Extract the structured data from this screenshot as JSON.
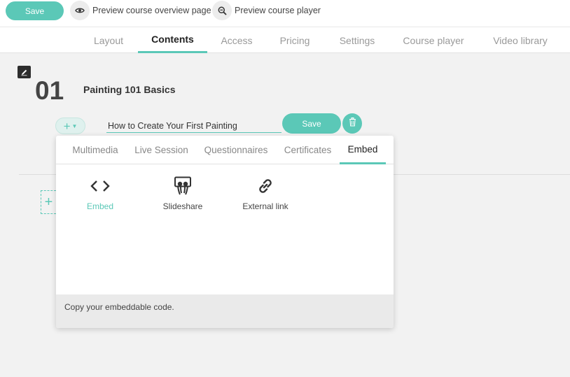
{
  "topbar": {
    "save_label": "Save",
    "preview_overview_label": "Preview course overview page",
    "preview_player_label": "Preview course player"
  },
  "tabs": [
    {
      "label": "Layout"
    },
    {
      "label": "Contents"
    },
    {
      "label": "Access"
    },
    {
      "label": "Pricing"
    },
    {
      "label": "Settings"
    },
    {
      "label": "Course player"
    },
    {
      "label": "Video library"
    }
  ],
  "active_tab": "Contents",
  "section": {
    "number": "01",
    "title": "Painting 101 Basics"
  },
  "lesson_editor": {
    "title_value": "How to Create Your First Painting",
    "save_label": "Save"
  },
  "popup": {
    "tabs": [
      {
        "label": "Multimedia"
      },
      {
        "label": "Live Session"
      },
      {
        "label": "Questionnaires"
      },
      {
        "label": "Certificates"
      },
      {
        "label": "Embed"
      }
    ],
    "active_tab": "Embed",
    "options": [
      {
        "label": "Embed",
        "icon": "code-icon"
      },
      {
        "label": "Slideshare",
        "icon": "slideshare-icon"
      },
      {
        "label": "External link",
        "icon": "link-icon"
      }
    ],
    "active_option": "Embed",
    "footer_text": "Copy your embeddable code."
  },
  "colors": {
    "accent": "#5bc8b7",
    "background": "#f2f2f2"
  }
}
